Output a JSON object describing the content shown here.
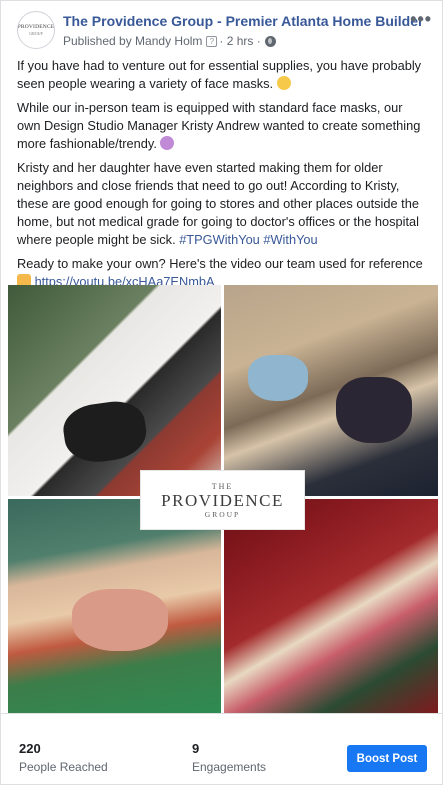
{
  "header": {
    "page_name": "The Providence Group - Premier Atlanta Home Builder",
    "published_by": "Published by Mandy Holm",
    "help_mark": "?",
    "time": "· 2 hrs ·",
    "more": "•••",
    "avatar_line1": "PROVIDENCE",
    "avatar_line2": "GROUP"
  },
  "post": {
    "p1": "If you have had to venture out for essential supplies, you have probably seen people wearing a variety of face masks.",
    "p2": "While our in-person team is equipped with standard face masks, our own Design Studio Manager Kristy Andrew wanted to create something more fashionable/trendy.",
    "p3_text": "Kristy and her daughter have even started making them for older neighbors and close friends that need to go out! According to Kristy, these are good enough for going to stores and other places outside the home, but not medical grade for going to doctor's offices or the hospital where people might be sick.",
    "p3_tags": "#TPGWithYou #WithYou",
    "p4_text": "Ready to make your own? Here's the video our team used for reference",
    "p4_link": "https://youtu.be/xcHAa7ENmbA"
  },
  "logo": {
    "the": "THE",
    "main": "PROVIDENCE",
    "group": "GROUP"
  },
  "footer": {
    "reached_count": "220",
    "reached_label": "People Reached",
    "engagements_count": "9",
    "engagements_label": "Engagements",
    "boost_label": "Boost Post"
  },
  "colors": {
    "link": "#385898",
    "boost": "#1877f2"
  }
}
